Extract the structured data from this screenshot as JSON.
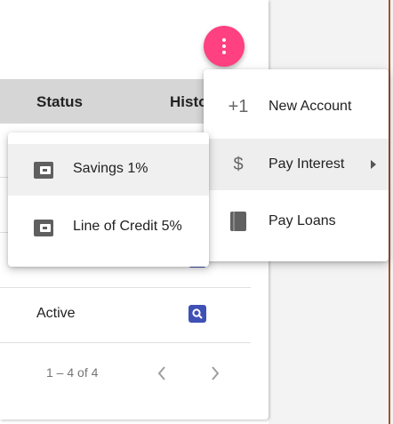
{
  "table": {
    "headers": {
      "status": "Status",
      "history": "Histo"
    },
    "rows": [
      {
        "status": "Active"
      }
    ],
    "pagination": {
      "range": "1 – 4 of 4",
      "prev_icon": "chevron-left-icon",
      "next_icon": "chevron-right-icon"
    }
  },
  "fab": {
    "icon": "more-vert-icon",
    "color": "#ff4081"
  },
  "menu": {
    "items": [
      {
        "icon": "+1",
        "label": "New Account"
      },
      {
        "icon": "$",
        "label": "Pay Interest",
        "has_submenu": true
      },
      {
        "icon": "book-icon",
        "label": "Pay Loans"
      }
    ]
  },
  "submenu": {
    "items": [
      {
        "icon": "wallet-icon",
        "label": "Savings 1%"
      },
      {
        "icon": "wallet-icon",
        "label": "Line of Credit 5%"
      }
    ]
  },
  "colors": {
    "accent": "#ff4081",
    "history_icon": "#3f51b5",
    "header_bg": "#d6d6d6"
  }
}
